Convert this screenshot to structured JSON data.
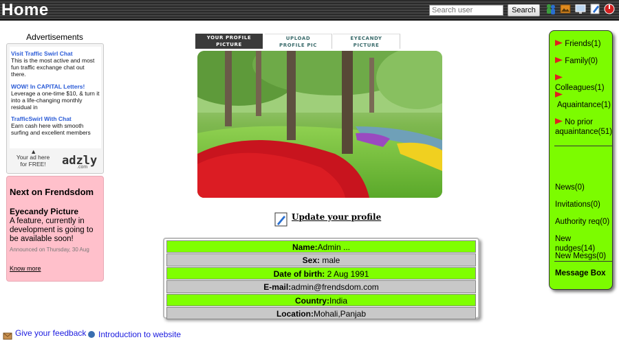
{
  "header": {
    "title": "Home",
    "search_placeholder": "Search user",
    "search_button": "Search",
    "icons": [
      "people-icon",
      "image-icon",
      "monitor-icon",
      "edit-icon",
      "logout-icon"
    ]
  },
  "ads": {
    "title": "Advertisements",
    "items": [
      {
        "title": "Visit Traffic Swirl Chat",
        "text": "This is the most active and most fun traffic exchange chat out there."
      },
      {
        "title": "WOW! In CAPITAL Letters!",
        "text": "Leverage a one-time $10, & turn it into a life-changing monthly residual in"
      },
      {
        "title": "TrafficSwirl With Chat",
        "text": "Earn cash here with smooth surfing and excellent members"
      }
    ],
    "cta": "Your ad here for FREE!",
    "logo": "adzly",
    "logo_suffix": ".com"
  },
  "next": {
    "title": "Next on Frendsdom",
    "feature": "Eyecandy Picture",
    "description": "A feature, currently in development is going to be available soon!",
    "announced": "Announced on Thursday, 30 Aug",
    "more": "Know more"
  },
  "tabs": [
    {
      "line1": "YOUR PROFILE",
      "line2": "PICTURE",
      "active": true
    },
    {
      "line1": "UPLOAD",
      "line2": "PROFILE PIC",
      "active": false
    },
    {
      "line1": "EYECANDY",
      "line2": "PICTURE",
      "active": false
    }
  ],
  "update_profile": "Update your profile",
  "profile": {
    "name_label": "Name:",
    "name": "Admin ...",
    "sex_label": "Sex:",
    "sex": "male",
    "dob_label": "Date of birth:",
    "dob": "2 Aug 1991",
    "email_label": "E-mail:",
    "email": "admin@frendsdom.com",
    "country_label": "Country:",
    "country": "India",
    "location_label": "Location:",
    "location": "Mohali,Panjab"
  },
  "right_panel": {
    "friends": "Friends(1)",
    "family": "Family(0)",
    "colleagues": "Colleagues(1)",
    "aquaintance": "Aquaintance(1)",
    "no_prior": "No prior aquaintance(51)",
    "news": "News(0)",
    "invitations": "Invitations(0)",
    "authority": "Authority req(0)",
    "nudges": "New nudges(14)",
    "mesgs": "New Mesgs(0)",
    "message_box": "Message Box"
  },
  "footer": {
    "feedback": "Give your feedback",
    "intro": "Introduction to website"
  },
  "colors": {
    "green": "#7cfc00",
    "pink": "#ffc0cb",
    "dark": "#2a2a2a",
    "link": "#1a1adf"
  }
}
